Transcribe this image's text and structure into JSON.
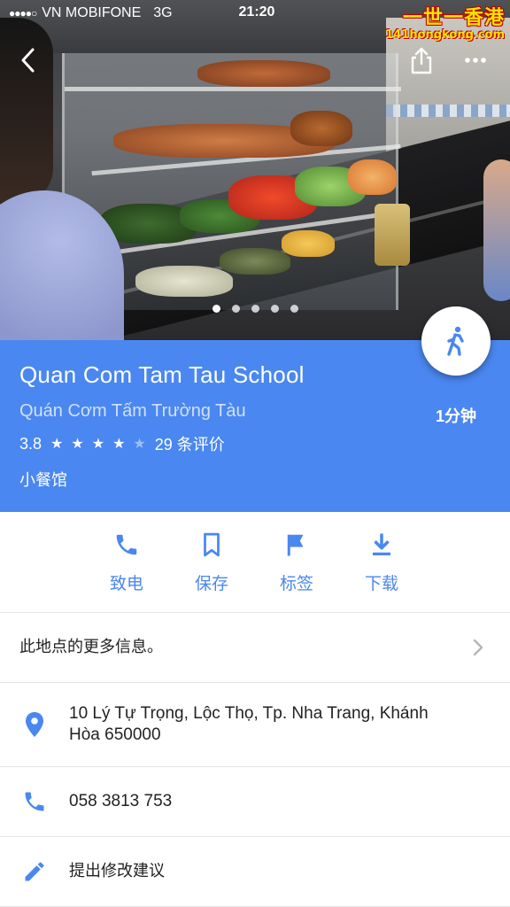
{
  "status_bar": {
    "signal": "●●●●○",
    "carrier": "VN MOBIFONE",
    "network": "3G",
    "time": "21:20"
  },
  "watermark": {
    "line1": "一世一香港",
    "line2": "141hongkong.com"
  },
  "header": {
    "back_icon": "chevron-left-icon",
    "share_icon": "share-icon",
    "more_icon": "more-horizontal-icon",
    "photo_pages": 5,
    "active_page": 1
  },
  "place": {
    "name": "Quan Com Tam Tau School",
    "local_name": "Quán Cơm Tấm Trường Tàu",
    "rating": "3.8",
    "rating_value": 3.8,
    "reviews": "29 条评价",
    "category": "小餐馆",
    "travel_time": "1分钟",
    "accent_color": "#4a87f0"
  },
  "actions": [
    {
      "label": "致电",
      "icon": "phone-icon"
    },
    {
      "label": "保存",
      "icon": "bookmark-icon"
    },
    {
      "label": "标签",
      "icon": "flag-icon"
    },
    {
      "label": "下载",
      "icon": "download-icon"
    }
  ],
  "details": {
    "more_info": "此地点的更多信息。",
    "address": "10 Lý Tự Trọng, Lộc Thọ, Tp. Nha Trang, Khánh Hòa 650000",
    "phone": "058 3813 753",
    "suggest_edit": "提出修改建议"
  }
}
